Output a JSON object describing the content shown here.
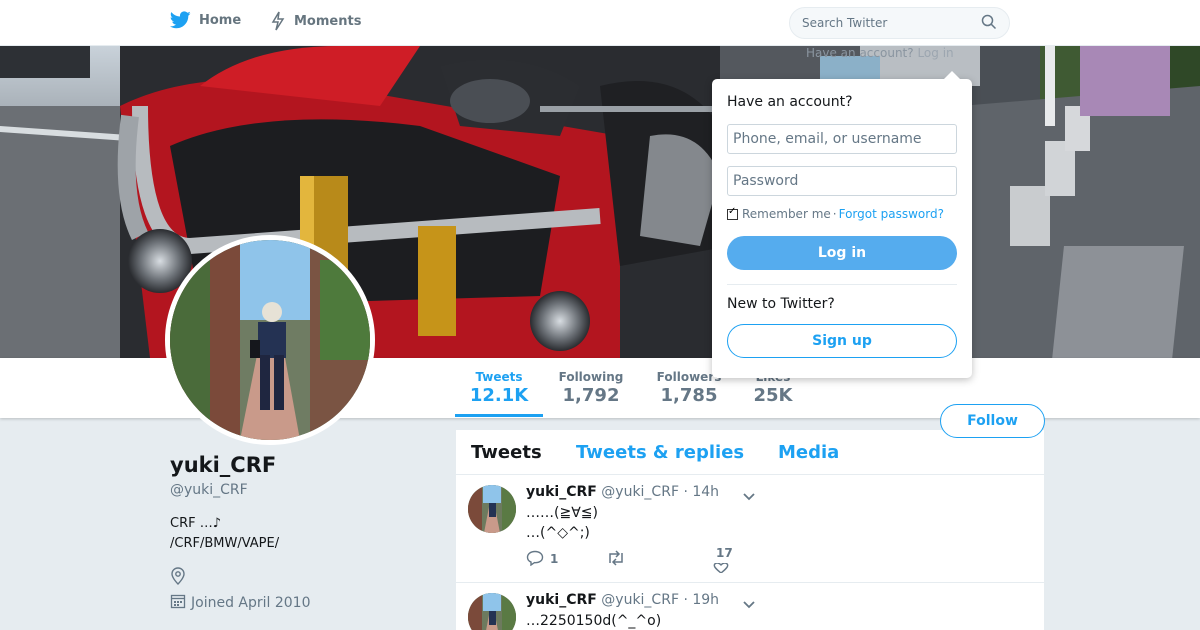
{
  "nav": {
    "home_label": "Home",
    "moments_label": "Moments",
    "search_placeholder": "Search Twitter",
    "have_account_text": "Have an account?",
    "login_link_text": "Log in"
  },
  "profile": {
    "name": "yuki_CRF",
    "handle": "@yuki_CRF",
    "bio_line1": "CRF …♪",
    "bio_line2": "/CRF/BMW/VAPE/",
    "joined": "Joined April 2010",
    "follow_label": "Follow"
  },
  "stats": [
    {
      "label": "Tweets",
      "value": "12.1K"
    },
    {
      "label": "Following",
      "value": "1,792"
    },
    {
      "label": "Followers",
      "value": "1,785"
    },
    {
      "label": "Likes",
      "value": "25K"
    }
  ],
  "timeline": {
    "tabs": [
      "Tweets",
      "Tweets & replies",
      "Media"
    ],
    "tweets": [
      {
        "name": "yuki_CRF",
        "handle": "@yuki_CRF",
        "time": "· 14h",
        "text": "……(≧∀≦)\n…(^◇^;)",
        "replies": "1",
        "retweets": "",
        "likes": "17"
      },
      {
        "name": "yuki_CRF",
        "handle": "@yuki_CRF",
        "time": "· 19h",
        "text": "…2250150d(^_^o)",
        "replies": "",
        "retweets": "",
        "likes": ""
      }
    ]
  },
  "login": {
    "title": "Have an account?",
    "username_placeholder": "Phone, email, or username",
    "password_placeholder": "Password",
    "remember_label": "Remember me",
    "separator": "·",
    "forgot_label": "Forgot password?",
    "login_button": "Log in",
    "new_label": "New to Twitter?",
    "signup_button": "Sign up"
  },
  "colors": {
    "accent": "#1da1f2",
    "login_button": "#55acee",
    "page_bg": "#e6ecf0"
  }
}
